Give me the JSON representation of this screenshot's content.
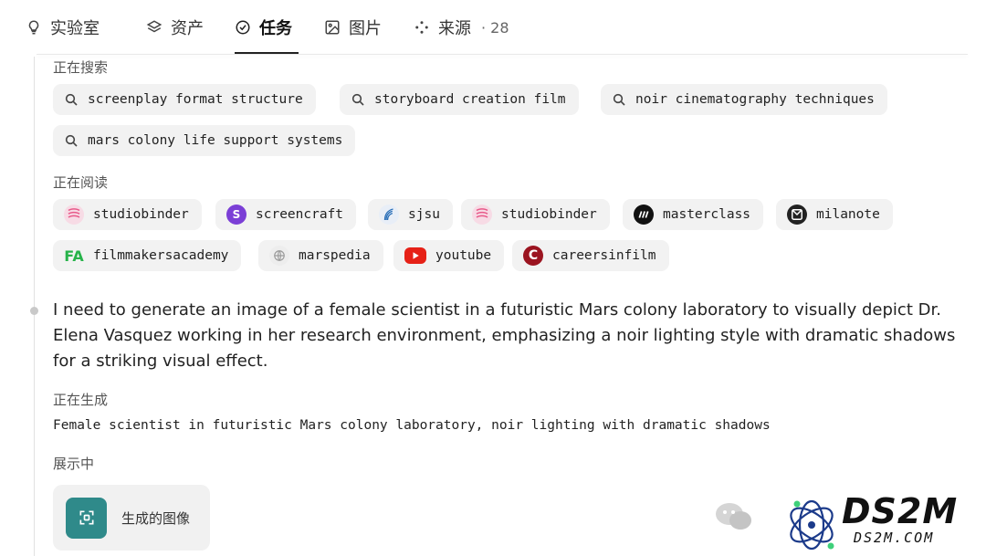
{
  "tabs": [
    {
      "label": "实验室",
      "icon": "lightbulb-icon"
    },
    {
      "label": "资产",
      "icon": "layers-icon"
    },
    {
      "label": "任务",
      "icon": "check-circle-icon",
      "active": true
    },
    {
      "label": "图片",
      "icon": "image-icon"
    },
    {
      "label": "来源",
      "icon": "sources-icon",
      "count": "· 28"
    }
  ],
  "searching": {
    "label": "正在搜索",
    "queries": [
      "screenplay format structure",
      "storyboard creation film",
      "noir cinematography techniques",
      "mars colony life support systems"
    ]
  },
  "reading": {
    "label": "正在阅读",
    "sources": [
      {
        "name": "studiobinder",
        "icon": "studiobinder-icon",
        "color": "#e85a8a"
      },
      {
        "name": "screencraft",
        "icon": "screencraft-icon",
        "color": "#7b3fd6"
      },
      {
        "name": "sjsu",
        "icon": "sjsu-icon",
        "color": "#2a6fb8"
      },
      {
        "name": "studiobinder",
        "icon": "studiobinder-icon",
        "color": "#e85a8a"
      },
      {
        "name": "masterclass",
        "icon": "masterclass-icon",
        "color": "#111111"
      },
      {
        "name": "milanote",
        "icon": "milanote-icon",
        "color": "#222222"
      },
      {
        "name": "filmmakersacademy",
        "icon": "filmmakersacademy-icon",
        "color": "#27b34a"
      },
      {
        "name": "marspedia",
        "icon": "globe-icon",
        "color": "#9a9a9a"
      },
      {
        "name": "youtube",
        "icon": "youtube-icon",
        "color": "#e62117"
      },
      {
        "name": "careersinfilm",
        "icon": "careersinfilm-icon",
        "color": "#9b1420"
      }
    ]
  },
  "message": "I need to generate an image of a female scientist in a futuristic Mars colony laboratory to visually depict Dr. Elena Vasquez working in her research environment, emphasizing a noir lighting style with dramatic shadows for a striking visual effect.",
  "generating": {
    "label": "正在生成",
    "query": "Female scientist in futuristic Mars colony laboratory, noir lighting with dramatic shadows"
  },
  "showing": {
    "label": "展示中",
    "image_label": "生成的图像"
  },
  "watermark": {
    "title": "DS2M",
    "subtitle": "DS2M.COM"
  }
}
